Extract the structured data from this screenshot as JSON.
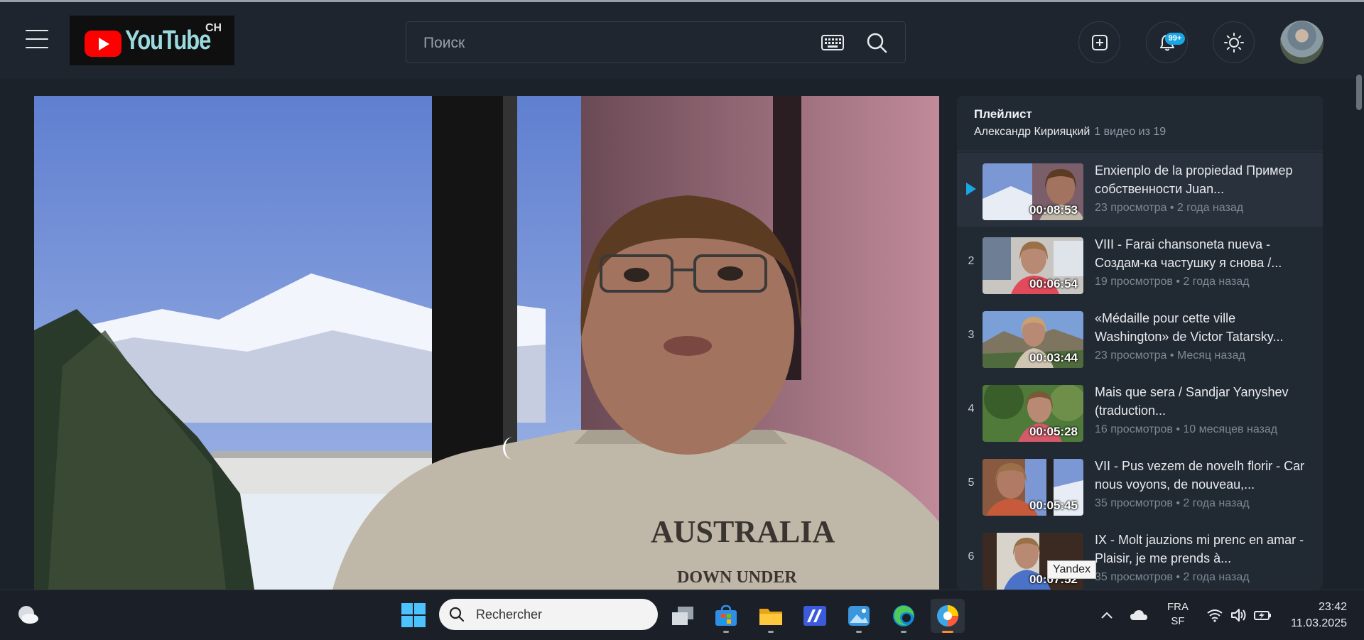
{
  "header": {
    "logo_text": "YouTube",
    "logo_region": "CH",
    "search_placeholder": "Поиск",
    "notification_badge": "99+"
  },
  "playlist": {
    "title": "Плейлист",
    "owner": "Александр Кирияцкий",
    "count": "1 видео из 19",
    "items": [
      {
        "index": "",
        "playing": true,
        "title": "Enxienplo de la propiedad Пример собственности Juan...",
        "duration": "00:08:53",
        "meta": "23 просмотра • 2 года назад"
      },
      {
        "index": "2",
        "title": "VIII - Farai chansoneta nueva - Создам-ка частушку я снова /...",
        "duration": "00:06:54",
        "meta": "19 просмотров • 2 года назад"
      },
      {
        "index": "3",
        "title": "«Médaille pour cette ville Washington» de Victor Tatarsky...",
        "duration": "00:03:44",
        "meta": "23 просмотра • Месяц назад"
      },
      {
        "index": "4",
        "title": "Mais que sera / Sandjar Yanyshev (traduction...",
        "duration": "00:05:28",
        "meta": "16 просмотров • 10 месяцев назад"
      },
      {
        "index": "5",
        "title": "VII - Pus vezem de novelh florir - Car nous voyons, de nouveau,...",
        "duration": "00:05:45",
        "meta": "35 просмотров • 2 года назад"
      },
      {
        "index": "6",
        "title": "IX - Molt jauzions mi prenc en amar - Plaisir, je me prends à...",
        "duration": "00:07:52",
        "meta": "35 просмотров • 2 года назад"
      }
    ]
  },
  "tooltip": "Yandex",
  "taskbar": {
    "search_placeholder": "Rechercher",
    "lang_top": "FRA",
    "lang_bottom": "SF",
    "time": "23:42",
    "date": "11.03.2025"
  },
  "icons": {
    "menu": "hamburger-icon",
    "keyboard": "keyboard-icon",
    "search": "search-icon",
    "create": "create-icon",
    "notifications": "bell-icon",
    "theme": "sun-icon",
    "windows": "windows-start-icon"
  },
  "colors": {
    "accent": "#1aa6e3",
    "youtube_red": "#ff0000",
    "background": "#1c222a",
    "active_app": "#ff8c2b"
  }
}
